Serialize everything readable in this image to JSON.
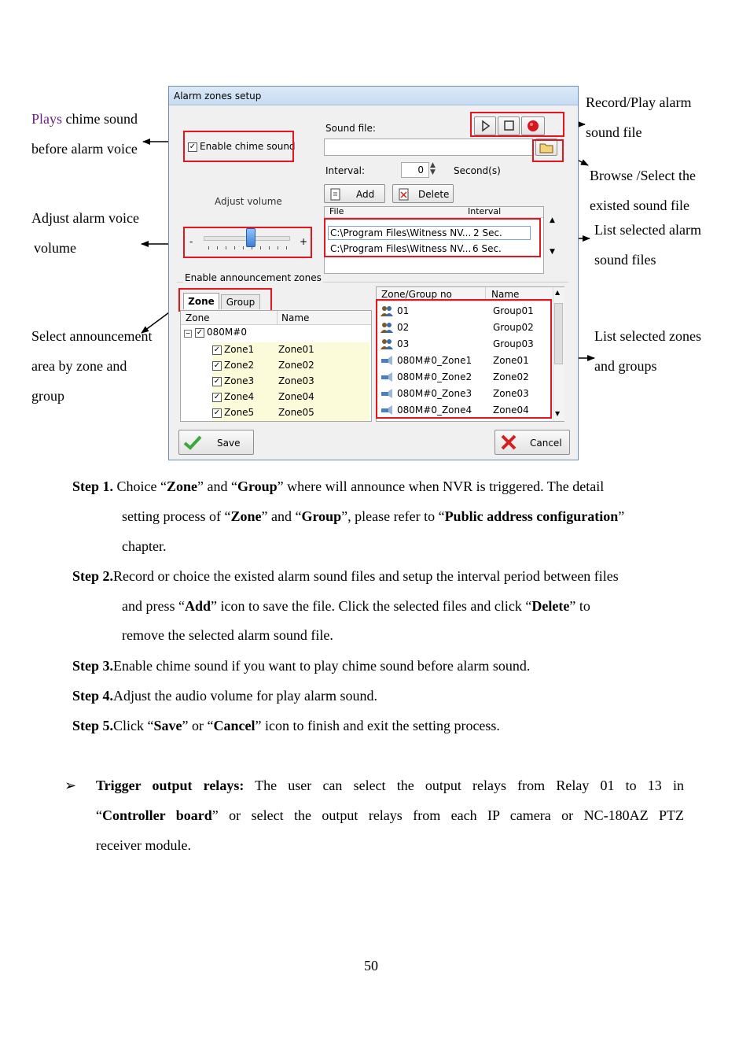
{
  "dialog": {
    "title": "Alarm zones setup",
    "enable_chime_label": "Enable chime sound",
    "adjust_volume_label": "Adjust volume",
    "slider_minus": "-",
    "slider_plus": "+",
    "volume_level": 0.55,
    "sound_file_label": "Sound file:",
    "sound_file_value": "",
    "interval_label": "Interval:",
    "interval_value": "0",
    "interval_unit": "Second(s)",
    "add_label": "Add",
    "delete_label": "Delete",
    "file_table": {
      "headers": [
        "File",
        "Interval"
      ],
      "rows": [
        {
          "file": "C:\\Program Files\\Witness NV...",
          "interval": "2 Sec."
        },
        {
          "file": "C:\\Program Files\\Witness NV...",
          "interval": "6 Sec."
        }
      ]
    },
    "announce_group_label": "Enable announcement zones",
    "tabs": [
      "Zone",
      "Group"
    ],
    "zone_tree": {
      "headers": [
        "Zone",
        "Name"
      ],
      "root": "080M#0",
      "rows": [
        {
          "zone": "Zone1",
          "name": "Zone01"
        },
        {
          "zone": "Zone2",
          "name": "Zone02"
        },
        {
          "zone": "Zone3",
          "name": "Zone03"
        },
        {
          "zone": "Zone4",
          "name": "Zone04"
        },
        {
          "zone": "Zone5",
          "name": "Zone05"
        }
      ]
    },
    "selected_table": {
      "headers": [
        "Zone/Group no",
        "Name"
      ],
      "rows": [
        {
          "no": "01",
          "name": "Group01",
          "kind": "group"
        },
        {
          "no": "02",
          "name": "Group02",
          "kind": "group"
        },
        {
          "no": "03",
          "name": "Group03",
          "kind": "group"
        },
        {
          "no": "080M#0_Zone1",
          "name": "Zone01",
          "kind": "zone"
        },
        {
          "no": "080M#0_Zone2",
          "name": "Zone02",
          "kind": "zone"
        },
        {
          "no": "080M#0_Zone3",
          "name": "Zone03",
          "kind": "zone"
        },
        {
          "no": "080M#0_Zone4",
          "name": "Zone04",
          "kind": "zone"
        }
      ]
    },
    "save_label": "Save",
    "cancel_label": "Cancel",
    "colors": {
      "highlight": "#e4151f",
      "title_bar": "#c6dbf2",
      "save_check": "#3aa83a",
      "cancel_x": "#d42020"
    }
  },
  "annotations": {
    "chime_line1_word": "Plays",
    "chime_line1_rest": " chime sound",
    "chime_line2": "before alarm voice",
    "volume_line1": "Adjust alarm voice",
    "volume_line2": "volume",
    "select_line1": "Select announcement",
    "select_line2": "area by zone and",
    "select_line3": "group",
    "record_line1": "Record/Play alarm",
    "record_line2": "sound file",
    "browse_line1": "Browse /Select the",
    "browse_line2": "existed sound file",
    "list_files_line1": "List selected alarm",
    "list_files_line2": "sound files",
    "list_zones_line1": "List selected zones",
    "list_zones_line2": "and groups"
  },
  "steps": {
    "s1_label": "Step 1.",
    "s1_a": " Choice “",
    "s1_zone": "Zone",
    "s1_b": "” and “",
    "s1_group": "Group",
    "s1_c": "” where will announce when NVR is triggered.    The detail",
    "s1_line2_a": "setting process of “",
    "s1_line2_zone": "Zone",
    "s1_line2_b": "” and “",
    "s1_line2_group": "Group",
    "s1_line2_c": "”, please refer to “",
    "s1_line2_ref": "Public address configuration",
    "s1_line2_d": "”",
    "s1_line3": "chapter.",
    "s2_label": "Step 2.",
    "s2_line1": "Record or choice the existed alarm sound files and setup the interval period between files",
    "s2_line2_a": "and press “",
    "s2_line2_add": "Add",
    "s2_line2_b": "” icon to save the file.    Click the selected files and click “",
    "s2_line2_del": "Delete",
    "s2_line2_c": "” to",
    "s2_line3": "remove the selected alarm sound file.",
    "s3_label": "Step 3.",
    "s3_text": "Enable chime sound if you want to play chime sound before alarm sound.",
    "s4_label": "Step 4.",
    "s4_text": "Adjust the audio volume for play alarm sound.",
    "s5_label": "Step 5.",
    "s5_a": "Click “",
    "s5_save": "Save",
    "s5_b": "” or “",
    "s5_cancel": "Cancel",
    "s5_c": "” icon to finish and exit the setting process."
  },
  "bullet": {
    "marker": "➢",
    "title": "Trigger output relays:",
    "line1_rest": " The user can select the output relays from Relay 01 to 13 in",
    "line2_a": "“",
    "line2_bold": "Controller board",
    "line2_b": "” or select the output relays from each IP camera or NC-180AZ PTZ",
    "line3": "receiver module."
  },
  "page_number": "50"
}
